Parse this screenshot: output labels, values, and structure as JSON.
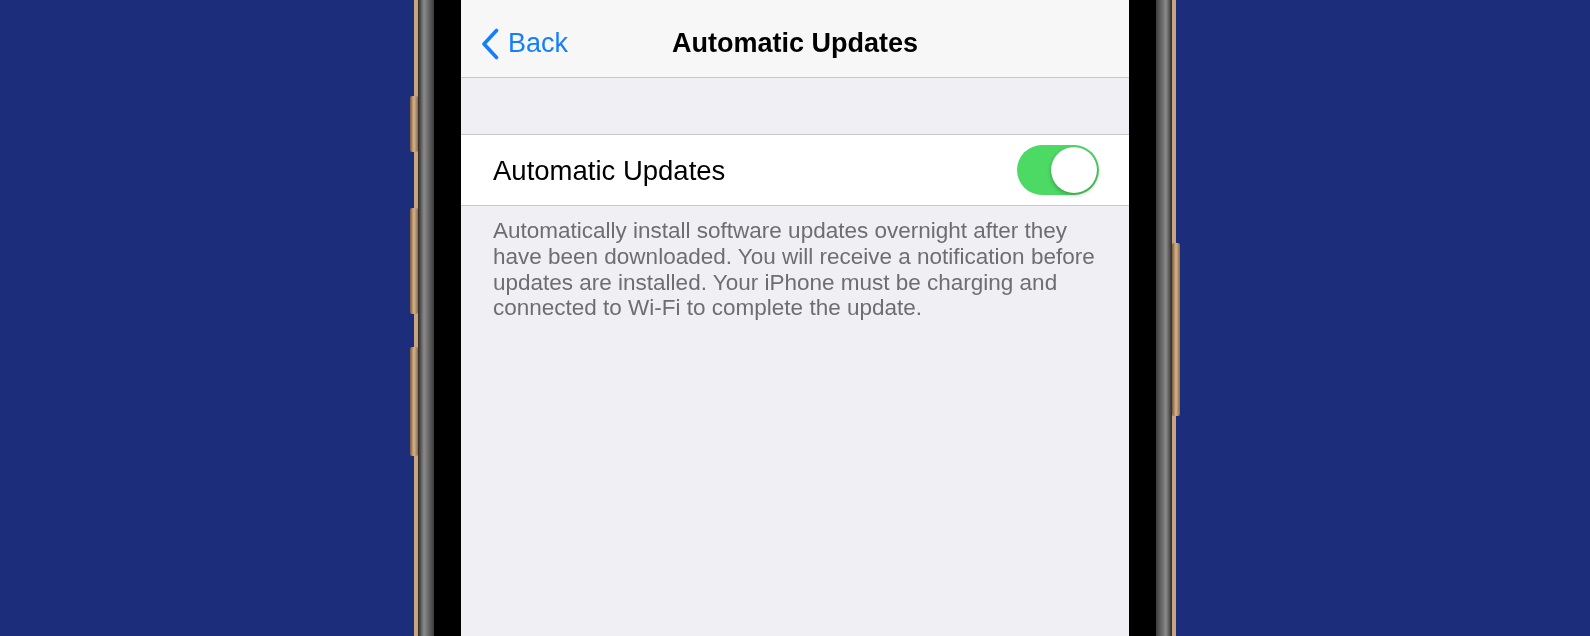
{
  "nav_bar": {
    "back_label": "Back",
    "title": "Automatic Updates"
  },
  "settings": [
    {
      "kind": "toggle",
      "label": "Automatic Updates",
      "on": true
    }
  ],
  "footer_note": "Automatically install software updates overnight after they have been downloaded. You will receive a notification before updates are installed. Your iPhone must be charging and connected to Wi-Fi to complete the update."
}
